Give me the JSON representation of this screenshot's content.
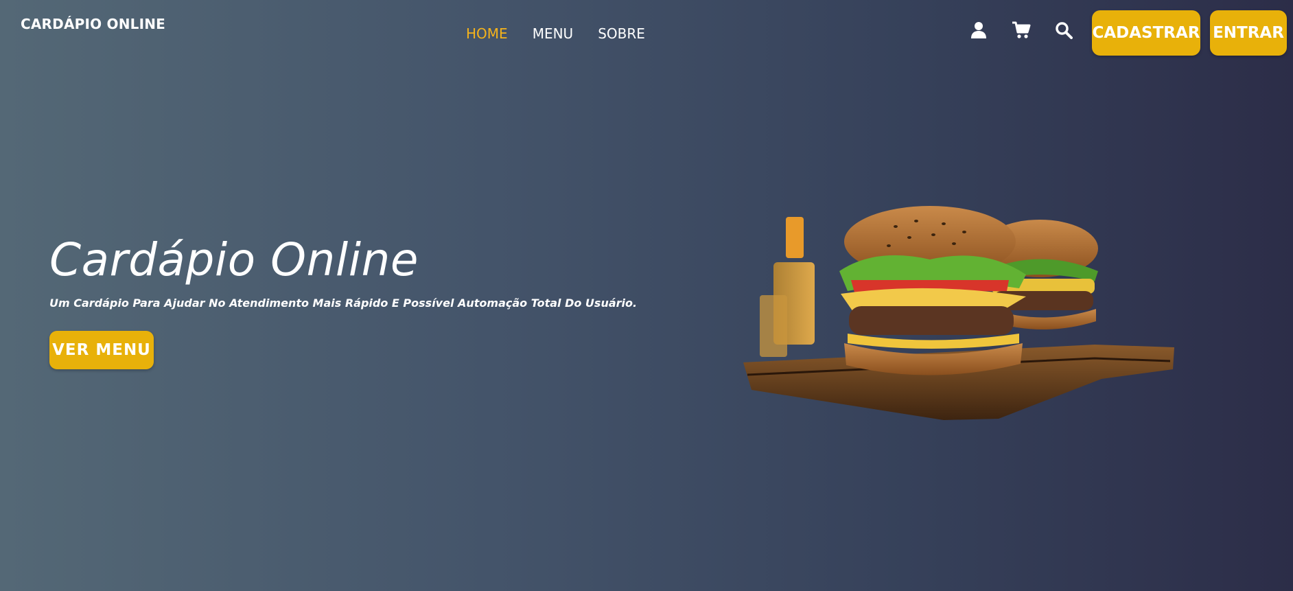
{
  "header": {
    "brand": "CARDÁPIO ONLINE",
    "nav": [
      {
        "label": "HOME",
        "active": true
      },
      {
        "label": "MENU",
        "active": false
      },
      {
        "label": "SOBRE",
        "active": false
      }
    ],
    "icons": [
      "user-icon",
      "cart-icon",
      "search-icon"
    ],
    "register_label": "CADASTRAR",
    "login_label": "ENTRAR"
  },
  "hero": {
    "title": "Cardápio Online",
    "subtitle": "Um Cardápio Para Ajudar No Atendimento Mais Rápido E Possível Automação Total Do Usuário.",
    "cta_label": "VER MENU",
    "image": "burger-on-wooden-board"
  },
  "colors": {
    "accent": "#e8b10a",
    "nav_active": "#f5b31b",
    "background_left": "#546876",
    "background_right": "#2c2d48"
  }
}
